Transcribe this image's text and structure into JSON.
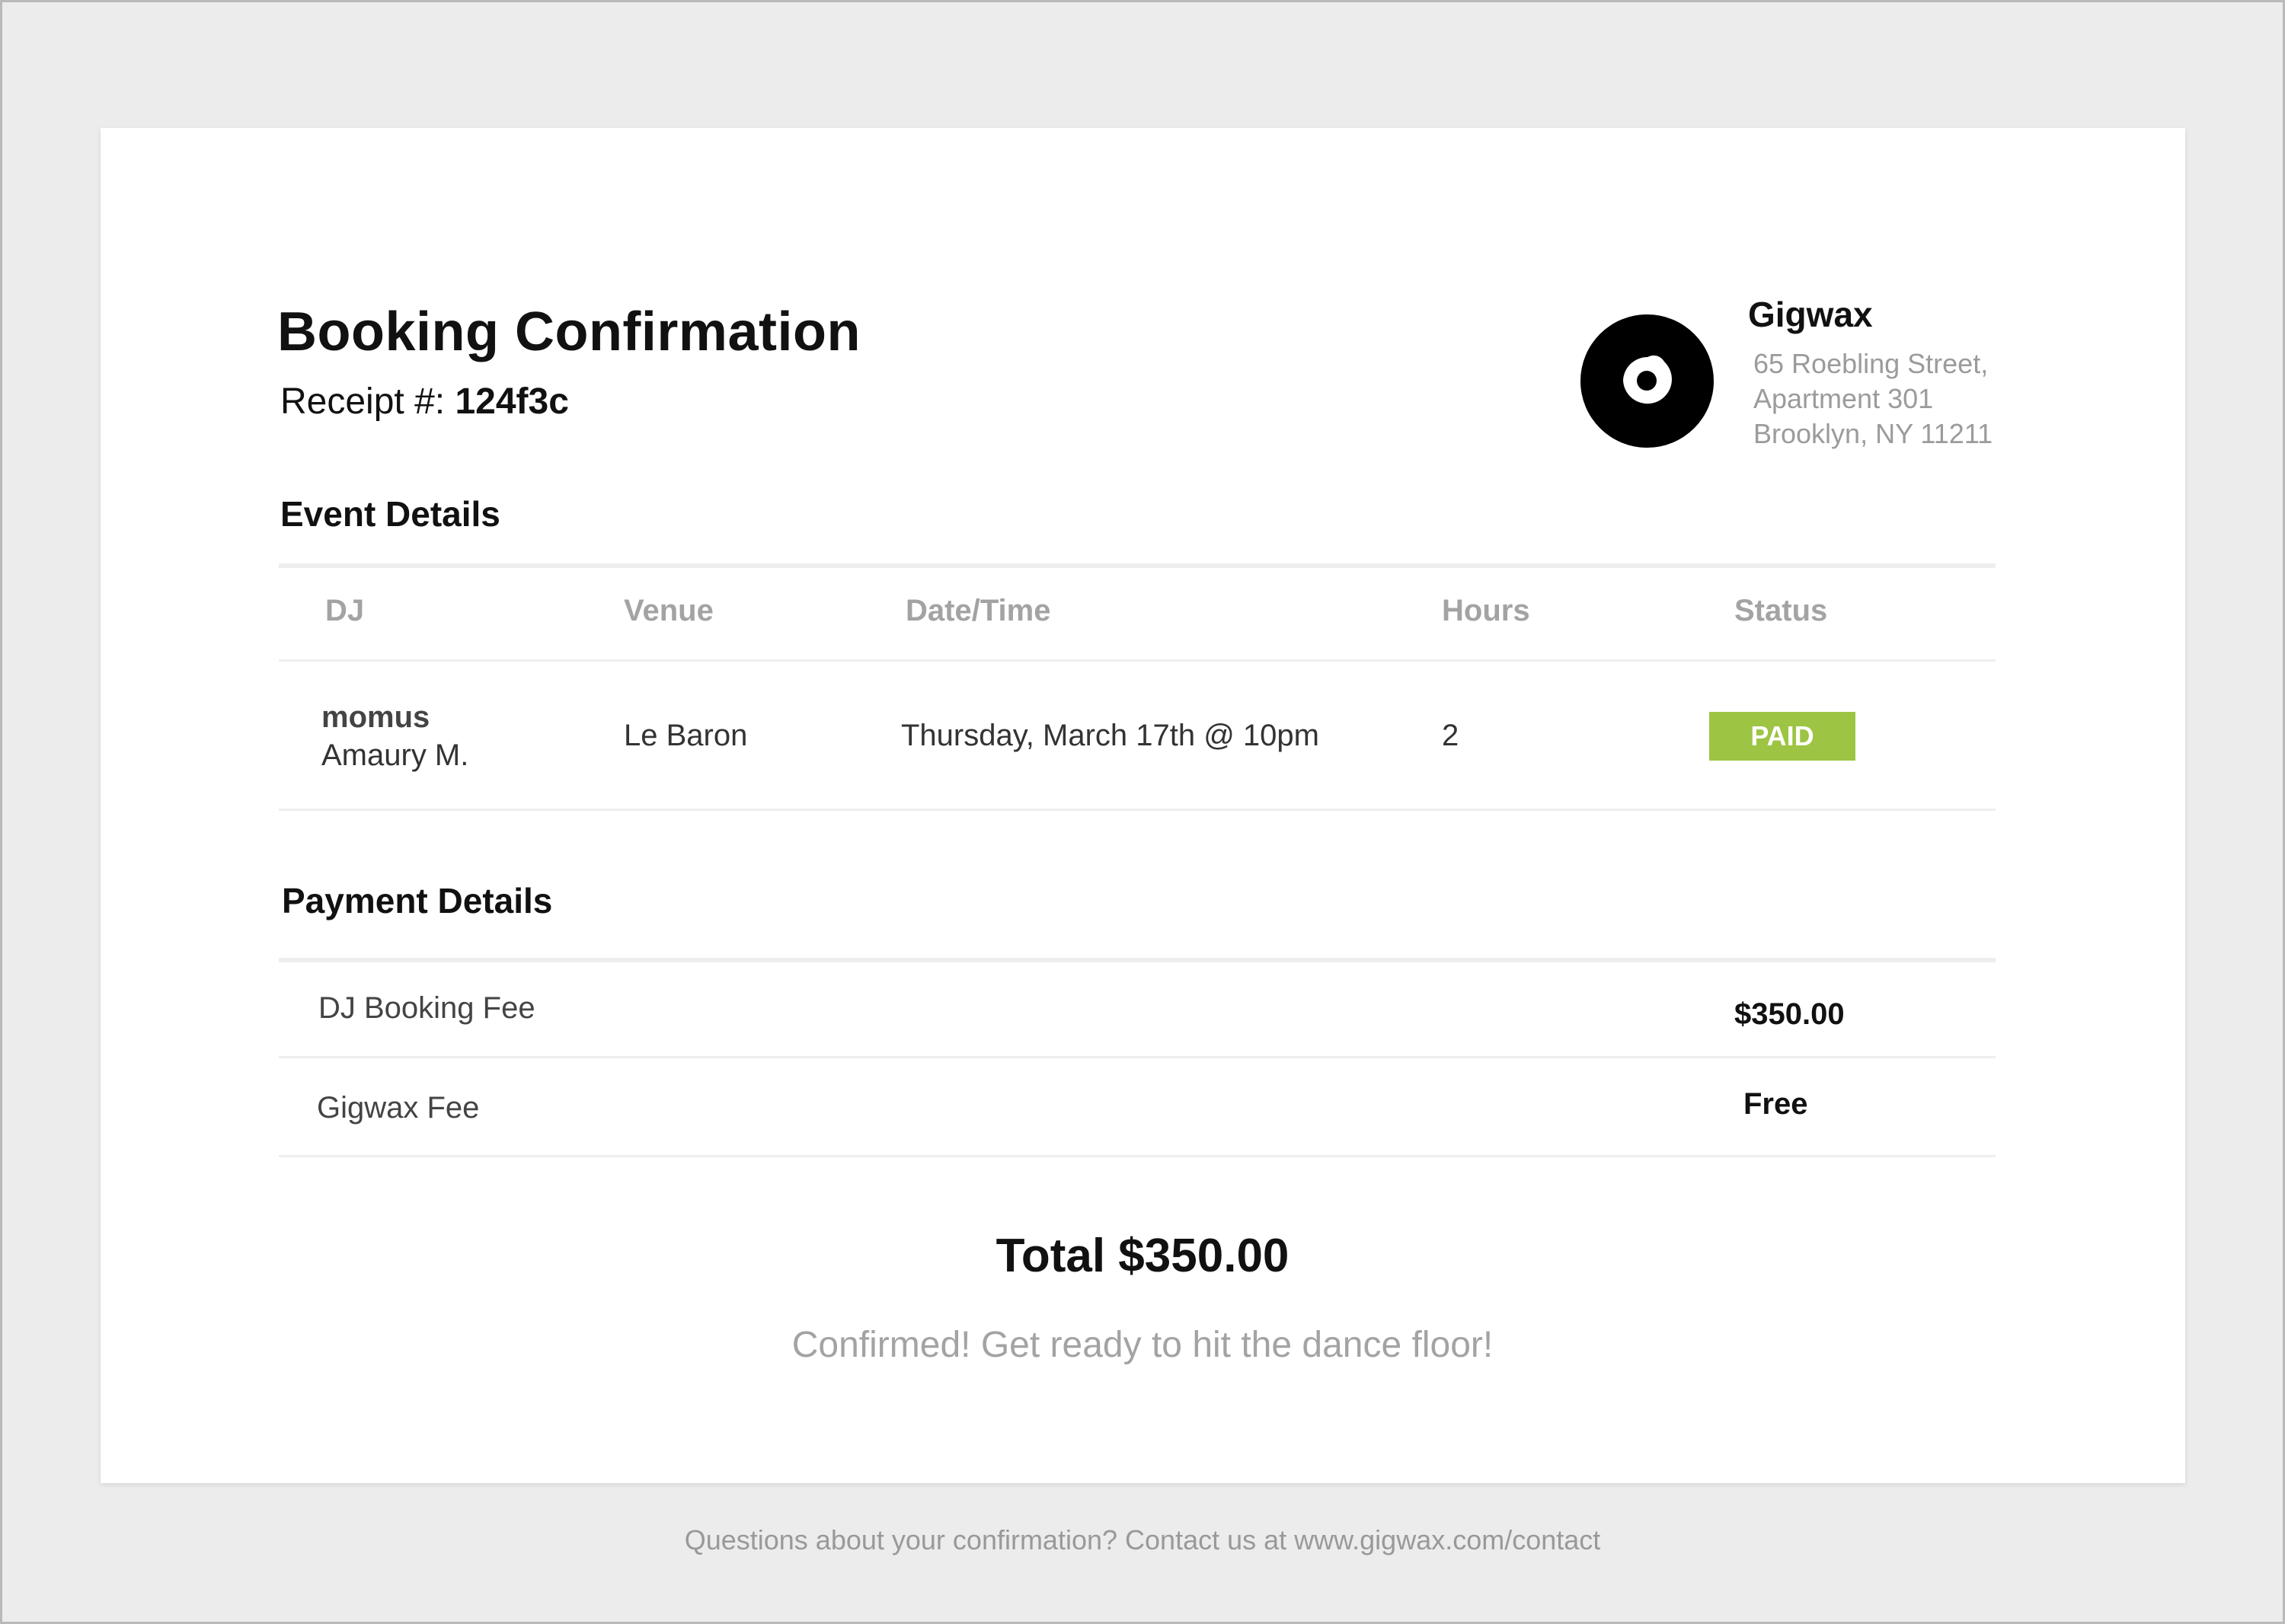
{
  "header": {
    "title": "Booking Confirmation",
    "receipt_label": "Receipt #:",
    "receipt_number": "124f3c"
  },
  "company": {
    "name": "Gigwax",
    "address_line1": "65 Roebling Street,",
    "address_line2": "Apartment 301",
    "address_line3": "Brooklyn, NY 11211",
    "logo_icon": "vinyl-record-icon"
  },
  "event": {
    "section_title": "Event Details",
    "columns": [
      "DJ",
      "Venue",
      "Date/Time",
      "Hours",
      "Status"
    ],
    "row": {
      "dj_name": "momus",
      "dj_real_name": "Amaury M.",
      "venue": "Le Baron",
      "datetime": "Thursday, March 17th @ 10pm",
      "hours": "2",
      "status": "PAID",
      "status_color": "#9dc443"
    }
  },
  "payment": {
    "section_title": "Payment Details",
    "items": [
      {
        "label": "DJ Booking Fee",
        "amount": "$350.00"
      },
      {
        "label": "Gigwax Fee",
        "amount": "Free"
      }
    ]
  },
  "total": "Total $350.00",
  "confirmation_message": "Confirmed! Get ready to hit the dance floor!",
  "footer": "Questions about your confirmation? Contact us at www.gigwax.com/contact"
}
